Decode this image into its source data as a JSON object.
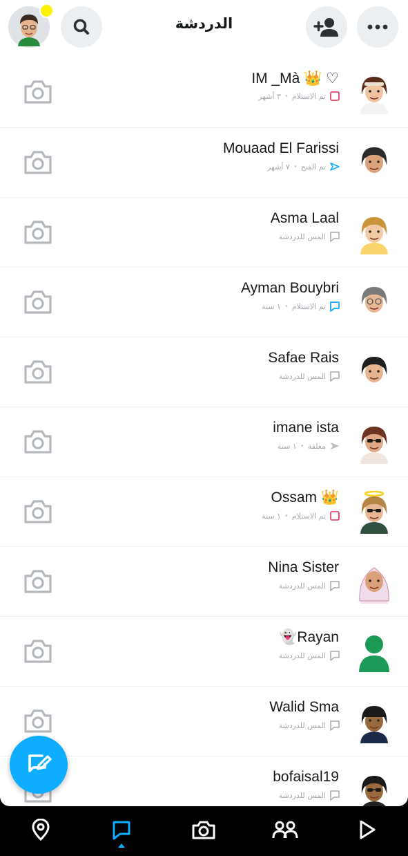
{
  "header": {
    "title": "الدردشة",
    "icons": {
      "profile": "bitmoji-avatar",
      "notification": "yellow-dot",
      "search": "search-icon",
      "add_friend": "add-friend-icon",
      "more": "more-icon"
    }
  },
  "chats": [
    {
      "name": "IM _Mà 👑 ♡",
      "status": "تم الاستلام",
      "time": "٣ أشهر",
      "status_icon": "snap-received",
      "status_color": "#e2466b"
    },
    {
      "name": "Mouaad El Farissi",
      "status": "تم الفتح",
      "time": "٧ أشهر",
      "status_icon": "chat-opened",
      "status_color": "#0fadff"
    },
    {
      "name": "Asma Laal",
      "status": "المس للدردشة",
      "time": "",
      "status_icon": "tap-to-chat",
      "status_color": "#a6abb1"
    },
    {
      "name": "Ayman Bouybri",
      "status": "تم الاستلام",
      "time": "١ سنة",
      "status_icon": "chat-received",
      "status_color": "#0fadff"
    },
    {
      "name": "Safae Rais",
      "status": "المس للدردشة",
      "time": "",
      "status_icon": "tap-to-chat",
      "status_color": "#a6abb1"
    },
    {
      "name": "imane ista",
      "status": "معلقة",
      "time": "١ سنة",
      "status_icon": "pending",
      "status_color": "#b8bcc1"
    },
    {
      "name": "Ossam 👑",
      "status": "تم الاستلام",
      "time": "١ سنة",
      "status_icon": "snap-received",
      "status_color": "#e2466b"
    },
    {
      "name": "Nina Sister",
      "status": "المس للدردشة",
      "time": "",
      "status_icon": "tap-to-chat",
      "status_color": "#a6abb1"
    },
    {
      "name": "👻Rayan",
      "status": "المس للدردشة",
      "time": "",
      "status_icon": "tap-to-chat",
      "status_color": "#a6abb1"
    },
    {
      "name": "Walid Sma",
      "status": "المس للدردشة",
      "time": "",
      "status_icon": "tap-to-chat",
      "status_color": "#a6abb1"
    },
    {
      "name": "bofaisal19",
      "status": "المس للدردشة",
      "time": "",
      "status_icon": "tap-to-chat",
      "status_color": "#a6abb1"
    }
  ],
  "fab": {
    "icon": "new-chat-icon",
    "color": "#0fadff"
  },
  "bottom_nav": {
    "items": [
      "map-icon",
      "chat-icon",
      "camera-icon",
      "friends-icon",
      "spotlight-icon"
    ],
    "active": "chat-icon",
    "active_color": "#0fadff"
  },
  "colors": {
    "accent": "#0fadff",
    "received_red": "#e2466b",
    "muted": "#a6abb1"
  }
}
